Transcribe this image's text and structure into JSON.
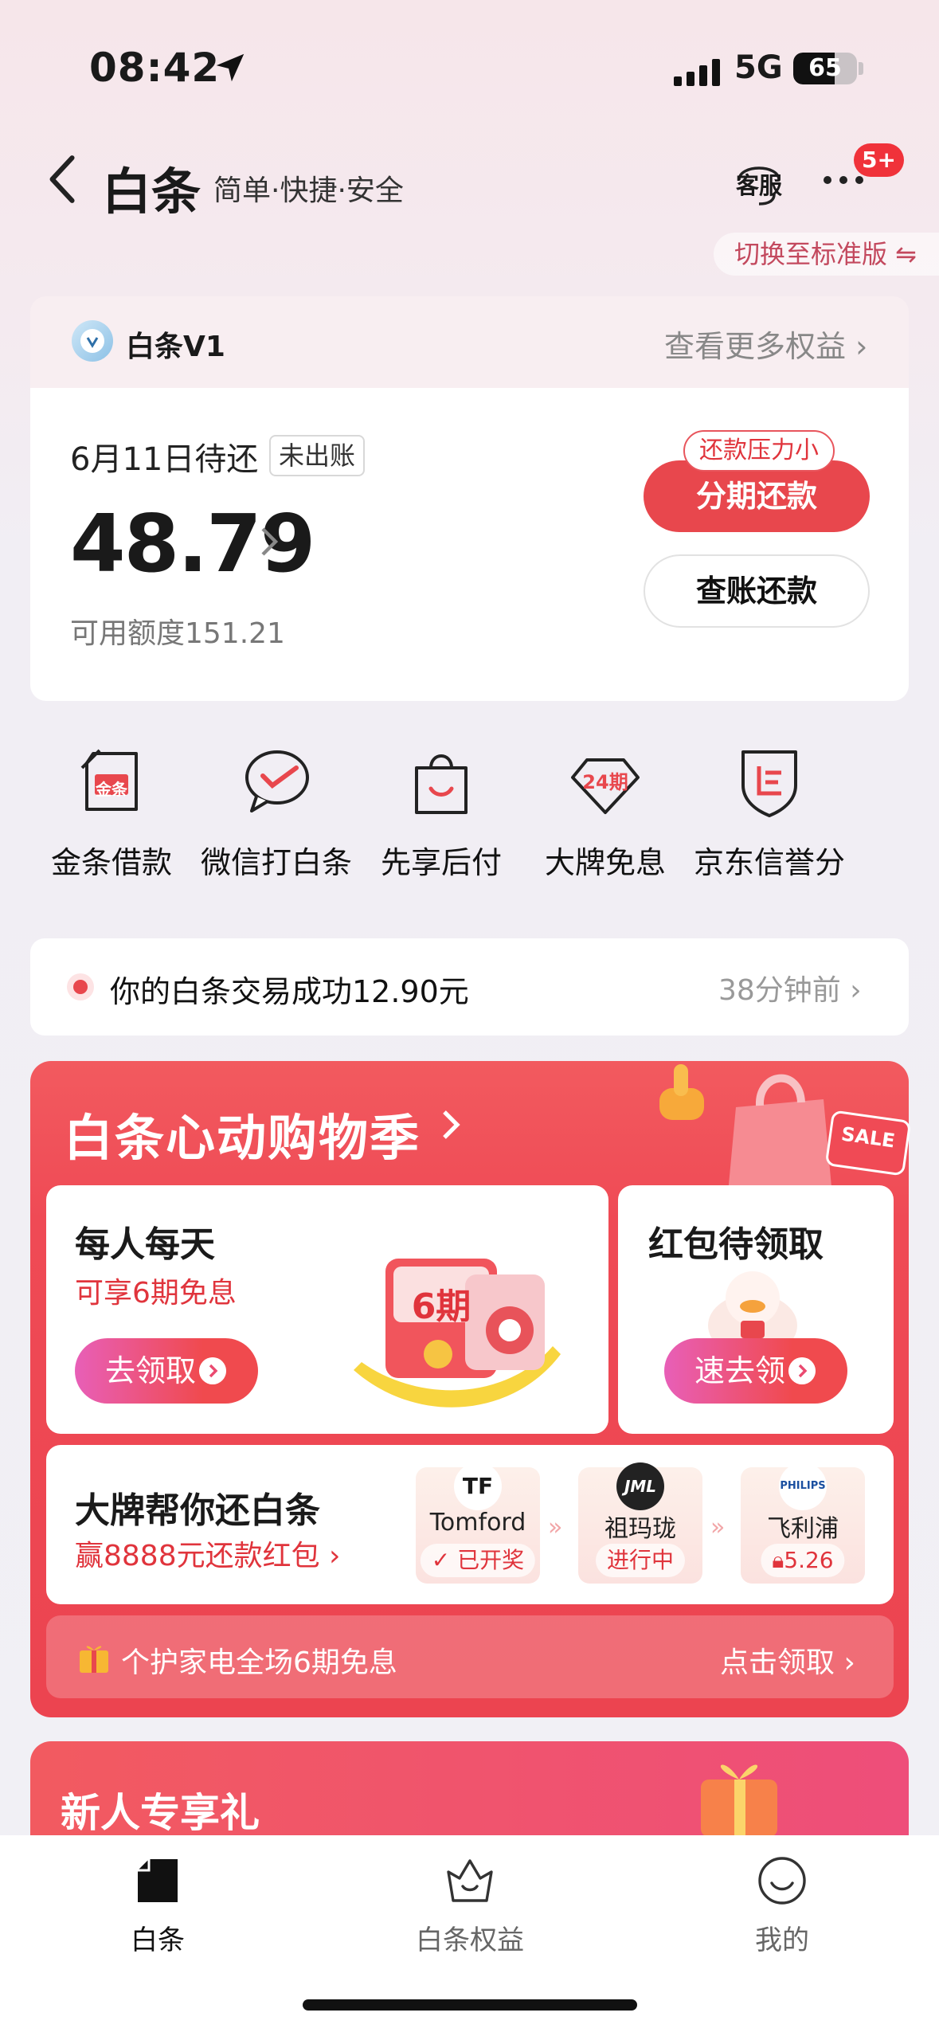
{
  "status_bar": {
    "time": "08:42",
    "network": "5G",
    "battery": "65",
    "battery_level": 0.65
  },
  "header": {
    "title": "白条",
    "subtitle": "简单·快捷·安全",
    "service_label": "客服",
    "badge": "5+",
    "switch_label": "切换至标准版 ⇋"
  },
  "level": {
    "name": "白条V1",
    "more": "查看更多权益 ›"
  },
  "bill": {
    "due_label": "6月11日待还",
    "status_tag": "未出账",
    "amount": "48.79",
    "credit": "可用额度151.21",
    "pressure_tag": "还款压力小",
    "installment_btn": "分期还款",
    "check_btn": "查账还款"
  },
  "shortcuts": [
    {
      "label": "金条借款",
      "icon": "gold-loan-icon",
      "icon_text": "金条"
    },
    {
      "label": "微信打白条",
      "icon": "wechat-icon"
    },
    {
      "label": "先享后付",
      "icon": "shopping-bag-icon"
    },
    {
      "label": "大牌免息",
      "icon": "diamond-24-icon",
      "icon_text": "24期"
    },
    {
      "label": "京东信誉分",
      "icon": "shield-score-icon"
    }
  ],
  "transaction": {
    "text": "你的白条交易成功12.90元",
    "time": "38分钟前 ›"
  },
  "promo": {
    "title": "白条心动购物季",
    "sale_label": "SALE",
    "daily": {
      "title": "每人每天",
      "subtitle": "可享6期免息",
      "button": "去领取",
      "art_text": "6期"
    },
    "redpack": {
      "title": "红包待领取",
      "button": "速去领"
    },
    "brand": {
      "title": "大牌帮你还白条",
      "subtitle": "赢8888元还款红包 ›",
      "steps": [
        {
          "logo": "TF",
          "name": "Tomford",
          "state": "已开奖"
        },
        {
          "logo": "JML",
          "name": "祖玛珑",
          "state": "进行中"
        },
        {
          "logo": "PHILIPS",
          "name": "飞利浦",
          "state": "5.26"
        }
      ]
    },
    "gift": {
      "text": "个护家电全场6期免息",
      "cta": "点击领取 ›"
    }
  },
  "newbie": {
    "title": "新人专享礼"
  },
  "tabs": [
    {
      "label": "白条",
      "icon": "baitiao-tab-icon"
    },
    {
      "label": "白条权益",
      "icon": "crown-icon"
    },
    {
      "label": "我的",
      "icon": "smile-face-icon"
    }
  ],
  "colors": {
    "accent": "#e8474d",
    "promo_bg": "#ef4a55",
    "text_red": "#e0343c"
  }
}
